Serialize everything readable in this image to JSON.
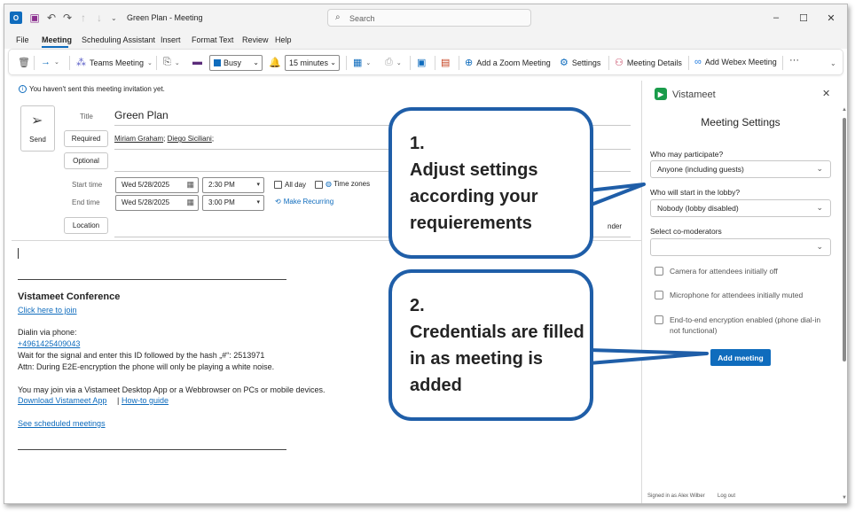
{
  "window": {
    "title": "Green Plan - Meeting",
    "search_placeholder": "Search",
    "controls": {
      "minimize": "–",
      "maximize": "☐",
      "close": "✕"
    }
  },
  "menu": {
    "items": [
      "File",
      "Meeting",
      "Scheduling Assistant",
      "Insert",
      "Format Text",
      "Review",
      "Help"
    ],
    "active": "Meeting"
  },
  "ribbon": {
    "teams_meeting": "Teams Meeting",
    "show_as": "Busy",
    "reminder": "15 minutes",
    "zoom": "Add a Zoom Meeting",
    "settings": "Settings",
    "meeting_details": "Meeting Details",
    "webex": "Add Webex Meeting",
    "more": "···"
  },
  "form": {
    "info": "You haven't sent this meeting invitation yet.",
    "send_label": "Send",
    "title_label": "Title",
    "title_value": "Green Plan",
    "required_label": "Required",
    "required_attendees": [
      "Miriam Graham",
      "Diego Siciliani"
    ],
    "optional_label": "Optional",
    "start_time_label": "Start time",
    "start_date": "Wed 5/28/2025",
    "start_time": "2:30 PM",
    "end_time_label": "End time",
    "end_date": "Wed 5/28/2025",
    "end_time": "3:00 PM",
    "all_day": "All day",
    "time_zones": "Time zones",
    "make_recurring": "Make Recurring",
    "location_label": "Location",
    "reminder_partial": "nder"
  },
  "body": {
    "conference_title": "Vistameet Conference",
    "join_link": "Click here to join",
    "dialin_label": "Dialin via phone:",
    "phone": "+4961425409043",
    "wait_text": "Wait for the signal and enter this ID followed by the hash „#“: 2513971",
    "attn_text": "Attn: During E2E-encryption the phone will only be playing a white noise.",
    "join_text": "You may join via a Vistameet Desktop App or a Webbrowser on PCs or mobile devices.",
    "download_link": "Download Vistameet App",
    "separator": "|",
    "howto_link": "How-to guide",
    "scheduled_link": "See scheduled meetings"
  },
  "panel": {
    "brand": "Vistameet",
    "heading": "Meeting Settings",
    "participate_label": "Who may participate?",
    "participate_value": "Anyone (including guests)",
    "lobby_label": "Who will start in the lobby?",
    "lobby_value": "Nobody (lobby disabled)",
    "comod_label": "Select co-moderators",
    "comod_value": "",
    "camera_option": "Camera for attendees initially off",
    "mic_option": "Microphone for attendees initially muted",
    "e2e_option": "End-to-end encryption enabled (phone dial-in not functional)",
    "add_button": "Add meeting",
    "signed_in": "Signed in as Alex Wilber",
    "logout": "Log out"
  },
  "callouts": {
    "one_number": "1.",
    "one_text": "Adjust settings according your requierements",
    "two_number": "2.",
    "two_text": "Credentials are filled in as meeting is added"
  },
  "colors": {
    "accent": "#0f6cbd",
    "callout_border": "#1f5ea8",
    "vistameet_green": "#1a9c4b"
  }
}
